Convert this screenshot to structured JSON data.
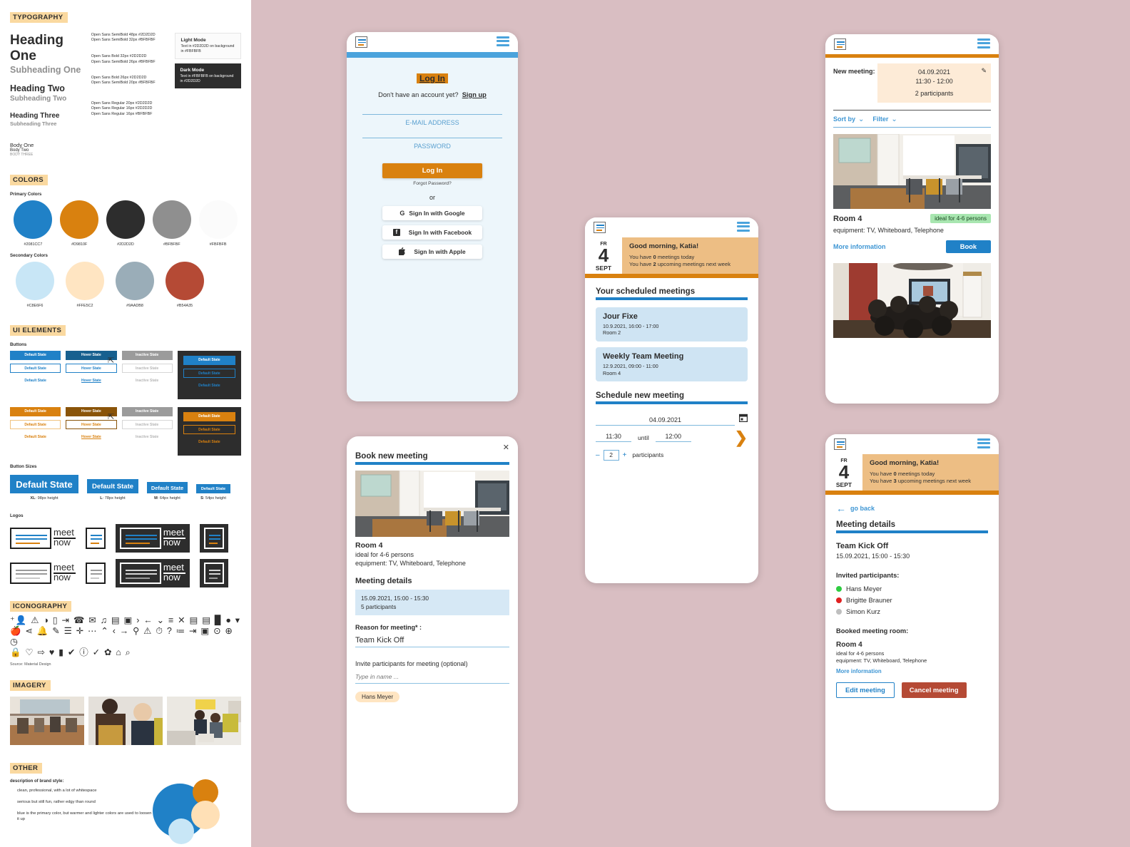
{
  "styleguide": {
    "sections": {
      "typography": "TYPOGRAPHY",
      "colors": "COLORS",
      "ui_elements": "UI ELEMENTS",
      "iconography": "ICONOGRAPHY",
      "imagery": "IMAGERY",
      "other": "OTHER"
    },
    "typography": {
      "samples": [
        {
          "title": "Heading One",
          "sub": "Subheading One"
        },
        {
          "title": "Heading Two",
          "sub": "Subheading Two"
        },
        {
          "title": "Heading Three",
          "sub": "Subheading Three"
        }
      ],
      "specs": [
        "Open Sans SemiBold 48px #2D2D2D",
        "Open Sans SemiBold 32px #BFBFBF",
        "Open Sans Bold 32px #2D2D2D",
        "Open Sans SemiBold 26px #BFBFBF",
        "Open Sans Bold 26px #2D2D2D",
        "Open Sans SemiBold 20px #BFBFBF"
      ],
      "body": [
        {
          "label": "Body One",
          "spec": "Open Sans Regular 20px #2D2D2D"
        },
        {
          "label": "Body Two",
          "spec": "Open Sans Regular 16px #2D2D2D"
        },
        {
          "label": "BODY THREE",
          "spec": "Open Sans Regular 16px #BFBFBF"
        }
      ],
      "modes": [
        {
          "name": "Light Mode",
          "desc": "Text in #2D2D2D on background in #FBFBFB"
        },
        {
          "name": "Dark Mode",
          "desc": "Text in #FBFBFB on background in #2D2D2D"
        }
      ]
    },
    "colors": {
      "primary_label": "Primary Colors",
      "secondary_label": "Secondary Colors",
      "primary": [
        {
          "hex": "#2081C7",
          "label": "#2081CC7"
        },
        {
          "hex": "#D9810F",
          "label": "#D9810F"
        },
        {
          "hex": "#2D2D2D",
          "label": "#2D2D2D"
        },
        {
          "hex": "#8F8F8F",
          "label": "#BFBFBF"
        },
        {
          "hex": "#FBFBFB",
          "label": "#FBFBFB"
        }
      ],
      "secondary": [
        {
          "hex": "#C8E6F6",
          "label": "#C8E6F6"
        },
        {
          "hex": "#FFE5C2",
          "label": "#FFE5C2"
        },
        {
          "hex": "#9AADB8",
          "label": "#9AADB8"
        },
        {
          "hex": "#B54A35",
          "label": "#B54A35"
        }
      ]
    },
    "buttons": {
      "label": "Buttons",
      "states": [
        "Default State",
        "Hover State",
        "Inactive State"
      ],
      "dark_label": "Default State",
      "sizes_label": "Button Sizes",
      "sizes": [
        {
          "label": "Default State",
          "cap_b": "XL",
          "cap": ": 98px height"
        },
        {
          "label": "Default State",
          "cap_b": "L",
          "cap": ": 78px height"
        },
        {
          "label": "Default State",
          "cap_b": "M",
          "cap": ": 64px height"
        },
        {
          "label": "Default State",
          "cap_b": "S",
          "cap": ": 54px height"
        }
      ]
    },
    "logos": {
      "label": "Logos",
      "word_top": "meet",
      "word_bottom": "now"
    },
    "icons": {
      "row1": "⁺👤 ⚠ ◑ ▯ ⇥ ☎ ✉ ♫ ▤ ▣ › ← ⌄ ≡ ✕ ▤ ▤ ▉ ● ▾",
      "row2": "🍎 ⋖ 🔔 ✎ ☰ ✛ ⋯ ⌃ ‹ → ⚲ ⚠ ⏱ ? ≔ ⇥ ▣ ⊙ ⊕ ◷",
      "row3": "🔒 ♡ ⇨ ♥ ▮ ✔ ⓘ ✓ ✿ ⌂ ⌕",
      "source": "Source: Material Design"
    },
    "other": {
      "desc_label": "description of brand style:",
      "lines": [
        "clean, professional, with a lot of whitespace",
        "serious but still fun, rather edgy than round",
        "blue is the primary color, but warmer and lighter colors are used to loosen it up"
      ]
    }
  },
  "login_screen": {
    "title": "Log In",
    "account_question": "Don't have an account yet?",
    "signup": "Sign up",
    "email_placeholder": "E-MAIL ADDRESS",
    "password_placeholder": "PASSWORD",
    "login_button": "Log In",
    "forgot": "Forgot Password?",
    "or": "or",
    "sso": [
      {
        "icon": "google-icon",
        "label": "Sign In with Google",
        "glyph": "G"
      },
      {
        "icon": "facebook-icon",
        "label": "Sign In with Facebook",
        "glyph": "f"
      },
      {
        "icon": "apple-icon",
        "label": "Sign In with Apple",
        "glyph": ""
      }
    ]
  },
  "book_meeting_card": {
    "close": "✕",
    "title": "Book new meeting",
    "room": {
      "name": "Room 4",
      "capacity": "ideal for 4-6 persons",
      "equipment": "equipment: TV, Whiteboard, Telephone"
    },
    "details_heading": "Meeting details",
    "details_datetime": "15.09.2021, 15:00 - 15:30",
    "details_participants": "5 participants",
    "reason_label": "Reason for meeting* :",
    "reason_value": "Team Kick Off",
    "invite_label": "Invite participants for meeting (optional)",
    "invite_placeholder": "Type in name ...",
    "chips": [
      "Hans Meyer"
    ]
  },
  "dashboard_screen": {
    "date": {
      "weekday": "FR",
      "day": "4",
      "month": "SEPT"
    },
    "greeting": {
      "title": "Good morning, Katia!",
      "line1_pre": "You have ",
      "line1_num": "0",
      "line1_post": " meetings today",
      "line2_pre": "You have ",
      "line2_num": "2",
      "line2_post": " upcoming meetings next week"
    },
    "scheduled_heading": "Your scheduled meetings",
    "meetings": [
      {
        "title": "Jour Fixe",
        "when": "10.9.2021, 16:00 - 17:00",
        "room": "Room 2"
      },
      {
        "title": "Weekly Team Meeting",
        "when": "12.9.2021, 09:00 - 11:00",
        "room": "Room 4"
      }
    ],
    "schedule_heading": "Schedule new meeting",
    "date_value": "04.09.2021",
    "time_from": "11:30",
    "until": "until",
    "time_to": "12:00",
    "participants_count": "2",
    "participants_label": "participants",
    "minus": "–",
    "plus": "+",
    "next_arrow": "❯"
  },
  "rooms_screen": {
    "new_meeting_label": "New meeting:",
    "new_meeting_date": "04.09.2021",
    "new_meeting_time": "11:30 - 12:00",
    "new_meeting_participants": "2 participants",
    "edit_icon": "✎",
    "sort_by": "Sort by",
    "filter": "Filter",
    "chevron": "⌄",
    "room": {
      "name": "Room 4",
      "badge": "ideal for 4-6 persons",
      "equipment": "equipment: TV, Whiteboard, Telephone",
      "more_info": "More information",
      "book": "Book"
    }
  },
  "details_screen": {
    "date": {
      "weekday": "FR",
      "day": "4",
      "month": "SEPT"
    },
    "greeting": {
      "title": "Good morning, Katia!",
      "line1_pre": "You have ",
      "line1_num": "0",
      "line1_post": " meetings today",
      "line2_pre": "You have ",
      "line2_num": "3",
      "line2_post": " upcoming meetings next week"
    },
    "go_back": "go back",
    "heading": "Meeting details",
    "meeting_title": "Team Kick Off",
    "meeting_when": "15.09.2021, 15:00 - 15:30",
    "invited_label": "Invited participants:",
    "participants": [
      {
        "name": "Hans Meyer",
        "status_color": "#2ECC40"
      },
      {
        "name": "Brigitte Brauner",
        "status_color": "#E02020"
      },
      {
        "name": "Simon Kurz",
        "status_color": "#BFBFBF"
      }
    ],
    "booked_label": "Booked meeting room:",
    "room": {
      "name": "Room 4",
      "capacity": "ideal for 4-6 persons",
      "equipment": "equipment: TV, Whiteboard, Telephone",
      "more_info": "More information"
    },
    "edit_button": "Edit meeting",
    "cancel_button": "Cancel meeting"
  }
}
